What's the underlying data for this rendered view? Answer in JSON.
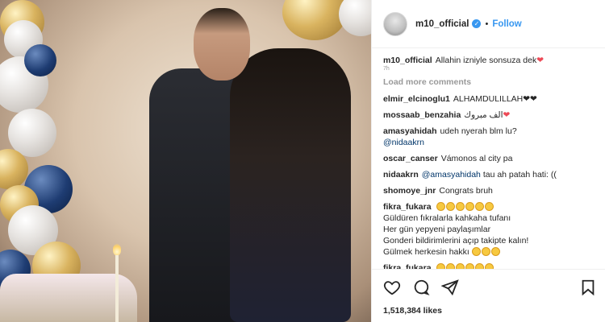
{
  "header": {
    "username": "m10_official",
    "separator": "•",
    "follow_label": "Follow"
  },
  "comments": {
    "caption": {
      "user": "m10_official",
      "text": "Allahin izniyle sonsuza dek",
      "emoji": "❤",
      "time": "7h"
    },
    "load_more_label": "Load more comments",
    "items": [
      {
        "user": "elmir_elcinoglu1",
        "text": "ALHAMDULILLAH",
        "emoji": "❤❤"
      },
      {
        "user": "mossaab_benzahia",
        "text": "الف مبروك",
        "emoji": "❤"
      },
      {
        "user": "amasyahidah",
        "text": "udeh nyerah blm lu?",
        "mention": "@nidaakrn"
      },
      {
        "user": "oscar_canser",
        "text": "Vámonos al city pa"
      },
      {
        "user": "nidaakrn",
        "mention": "@amasyahidah",
        "text": "tau ah patah hati: (("
      },
      {
        "user": "shomoye_jnr",
        "text": "Congrats bruh"
      },
      {
        "user": "fikra_fukara",
        "lines": [
          "Güldüren fıkralarla kahkaha tufanı",
          "Her gün yepyeni paylaşımlar",
          "Gonderi bildirimlerini açıp takipte kalın!",
          "Gülmek herkesin hakkı"
        ]
      },
      {
        "user": "fikra_fukara"
      }
    ]
  },
  "actions": {
    "likes": "1,518,384 likes"
  },
  "icons": {
    "verified": "verified-badge-icon",
    "like": "heart-outline-icon",
    "comment": "comment-bubble-icon",
    "share": "share-arrow-icon",
    "save": "bookmark-icon"
  },
  "colors": {
    "accent": "#3897f0",
    "heart": "#ed4956",
    "border": "#efefef"
  }
}
